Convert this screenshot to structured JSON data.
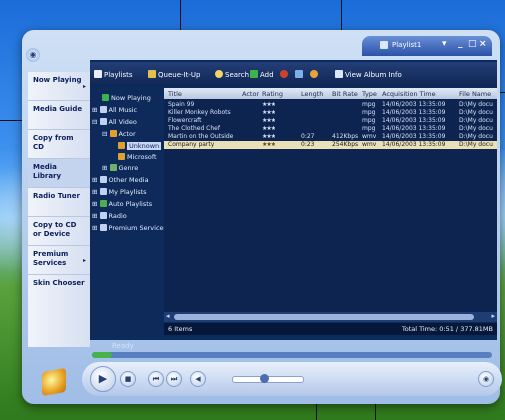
{
  "window": {
    "title": "Playlist1",
    "controls": {
      "dropdown": "▾",
      "minimize": "_",
      "maximize": "□",
      "close": "×"
    }
  },
  "taskbar": {
    "items": [
      {
        "label": "Now Playing",
        "arrow": "▸"
      },
      {
        "label": "Media Guide",
        "arrow": ""
      },
      {
        "label": "Copy from CD",
        "arrow": ""
      },
      {
        "label": "Media Library",
        "arrow": ""
      },
      {
        "label": "Radio Tuner",
        "arrow": ""
      },
      {
        "label": "Copy to CD or Device",
        "arrow": ""
      },
      {
        "label": "Premium Services",
        "arrow": "▸"
      },
      {
        "label": "Skin Chooser",
        "arrow": ""
      }
    ]
  },
  "toolbar": {
    "playlists": "Playlists",
    "queue": "Queue-It-Up",
    "search": "Search",
    "add": "Add",
    "view_info": "View Album Info"
  },
  "tree": {
    "items": [
      {
        "label": "Now Playing",
        "icon": "play-icon",
        "color": "#3db34a"
      },
      {
        "label": "All Music",
        "icon": "music-icon",
        "color": "#c0d2f2"
      },
      {
        "label": "All Video",
        "icon": "video-icon",
        "color": "#c0d2f2"
      },
      {
        "label": "Actor",
        "icon": "person-icon",
        "color": "#e0a030"
      },
      {
        "label": "Unknown",
        "icon": "person-icon",
        "color": "#e0a030"
      },
      {
        "label": "Microsoft",
        "icon": "person-icon",
        "color": "#e0a030"
      },
      {
        "label": "Genre",
        "icon": "genre-icon",
        "color": "#6fb06a"
      },
      {
        "label": "Other Media",
        "icon": "media-icon",
        "color": "#c0d2f2"
      },
      {
        "label": "My Playlists",
        "icon": "playlist-icon",
        "color": "#c0d2f2"
      },
      {
        "label": "Auto Playlists",
        "icon": "auto-playlist-icon",
        "color": "#4cae4c"
      },
      {
        "label": "Radio",
        "icon": "radio-icon",
        "color": "#c0d2f2"
      },
      {
        "label": "Premium Services",
        "icon": "services-icon",
        "color": "#c0d2f2"
      }
    ]
  },
  "grid": {
    "columns": [
      "Title",
      "Actor",
      "Rating",
      "Length",
      "Bit Rate",
      "Type",
      "Acquisition Time",
      "File Name"
    ],
    "rows": [
      {
        "title": "Spain 99",
        "actor": "",
        "rating": "★★★",
        "length": "",
        "bitrate": "",
        "type": "mpg",
        "time": "14/06/2003 13:35:09",
        "file": "D:\\My docu"
      },
      {
        "title": "Killer Monkey Robots",
        "actor": "",
        "rating": "★★★",
        "length": "",
        "bitrate": "",
        "type": "mpg",
        "time": "14/06/2003 13:35:09",
        "file": "D:\\My docu"
      },
      {
        "title": "Flowercraft",
        "actor": "",
        "rating": "★★★",
        "length": "",
        "bitrate": "",
        "type": "mpg",
        "time": "14/06/2003 13:35:09",
        "file": "D:\\My docu"
      },
      {
        "title": "The Clothed Chef",
        "actor": "",
        "rating": "★★★",
        "length": "",
        "bitrate": "",
        "type": "mpg",
        "time": "14/06/2003 13:35:09",
        "file": "D:\\My docu"
      },
      {
        "title": "Martin on the Outside",
        "actor": "",
        "rating": "★★★",
        "length": "0:27",
        "bitrate": "412Kbps",
        "type": "wmv",
        "time": "14/06/2003 13:35:09",
        "file": "D:\\My docu"
      },
      {
        "title": "Company party",
        "actor": "",
        "rating": "★★★",
        "length": "0:23",
        "bitrate": "254Kbps",
        "type": "wmv",
        "time": "14/06/2003 13:35:09",
        "file": "D:\\My docu"
      }
    ]
  },
  "status": {
    "items": "6 Items",
    "total_time": "Total Time: 0:51 / 377.81MB",
    "ready": "Ready"
  },
  "player": {
    "play": "▶",
    "stop": "■",
    "prev": "⏮",
    "next": "⏭",
    "mute": "◀",
    "seek_progress": 0.05,
    "volume_level": 0.45
  },
  "colors": {
    "accent": "#2a52a8",
    "highlight_row": "#eae0b8",
    "star": "#d9a23a"
  }
}
